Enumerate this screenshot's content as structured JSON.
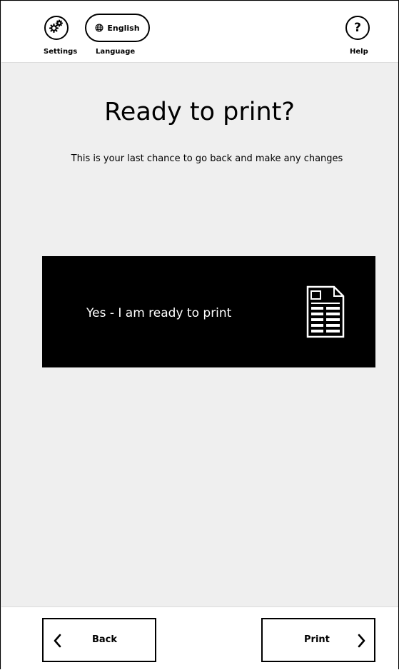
{
  "header": {
    "settings_caption": "Settings",
    "language_value": "English",
    "language_caption": "Language",
    "help_symbol": "?",
    "help_caption": "Help",
    "icons": {
      "settings": "gears-icon",
      "language": "globe-icon",
      "help": "question-icon"
    }
  },
  "main": {
    "title": "Ready to print?",
    "subtitle": "This is your last chance to go back and make any changes",
    "ready_button": {
      "label": "Yes - I am ready to print",
      "icon": "document-icon"
    }
  },
  "footer": {
    "back_label": "Back",
    "print_label": "Print",
    "back_icon": "chevron-left-icon",
    "print_icon": "chevron-right-icon"
  },
  "colors": {
    "background": "#efefef",
    "header_footer": "#ffffff",
    "button_dark": "#000000",
    "text": "#000000"
  }
}
